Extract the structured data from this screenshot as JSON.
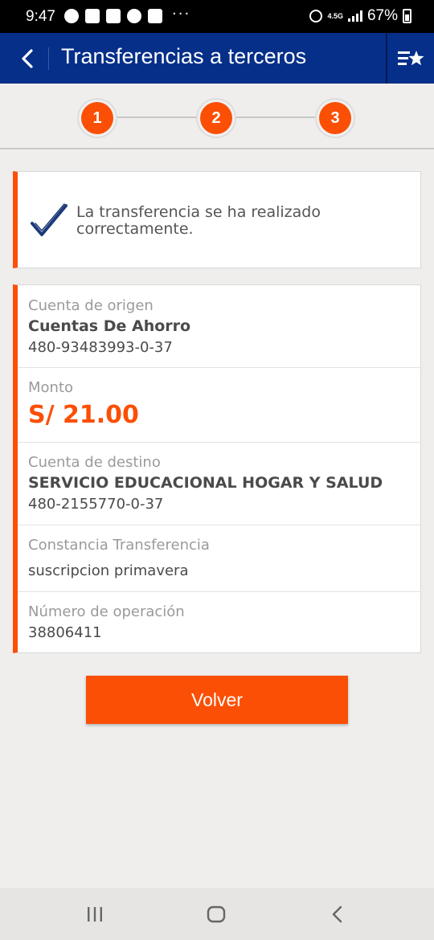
{
  "status_bar": {
    "time": "9:47",
    "network": "4.5G",
    "battery": "67%",
    "more": "···"
  },
  "header": {
    "back_icon": "chevron-left-icon",
    "title": "Transferencias a terceros",
    "favorites_icon": "list-star-icon"
  },
  "stepper": {
    "steps": [
      "1",
      "2",
      "3"
    ],
    "accent": "#fb4f05"
  },
  "success": {
    "icon": "check-icon",
    "message": "La transferencia se ha realizado correctamente."
  },
  "details": {
    "origin": {
      "label": "Cuenta de origen",
      "name": "Cuentas De Ahorro",
      "number": "480-93483993-0-37"
    },
    "amount": {
      "label": "Monto",
      "value": "S/ 21.00"
    },
    "destination": {
      "label": "Cuenta de destino",
      "name": "SERVICIO EDUCACIONAL HOGAR Y SALUD",
      "number": "480-2155770-0-37"
    },
    "receipt": {
      "label": "Constancia Transferencia",
      "value": "suscripcion primavera"
    },
    "operation": {
      "label": "Número de operación",
      "value": "38806411"
    }
  },
  "actions": {
    "back_label": "Volver"
  },
  "colors": {
    "brand_blue": "#062f8a",
    "accent_orange": "#fb4f05"
  }
}
